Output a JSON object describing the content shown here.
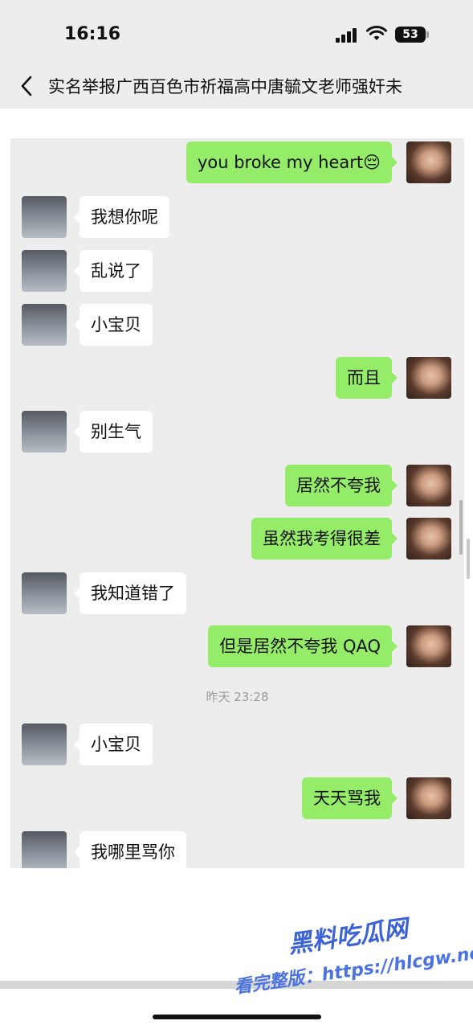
{
  "status_bar": {
    "time": "16:16",
    "battery": "53"
  },
  "nav": {
    "title": "实名举报广西百色市祈福高中唐毓文老师强奸未"
  },
  "messages": [
    {
      "side": "right",
      "text": "you broke my heart😔"
    },
    {
      "side": "left",
      "text": "我想你呢"
    },
    {
      "side": "left",
      "text": "乱说了"
    },
    {
      "side": "left",
      "text": "小宝贝"
    },
    {
      "side": "right",
      "text": "而且"
    },
    {
      "side": "left",
      "text": "别生气"
    },
    {
      "side": "right",
      "text": "居然不夸我"
    },
    {
      "side": "right",
      "text": "虽然我考得很差"
    },
    {
      "side": "left",
      "text": "我知道错了"
    },
    {
      "side": "right",
      "text": "但是居然不夸我 QAQ"
    },
    {
      "side": "left",
      "text": "小宝贝"
    },
    {
      "side": "right",
      "text": "天天骂我"
    },
    {
      "side": "left",
      "text": "我哪里骂你"
    }
  ],
  "timestamp": "昨天 23:28",
  "watermark": {
    "line1": "黑料吃瓜网",
    "line2": "看完整版：https://hlcgw.net"
  },
  "colors": {
    "sent_bubble": "#95ec69",
    "received_bubble": "#ffffff",
    "chat_background": "#ededed"
  }
}
